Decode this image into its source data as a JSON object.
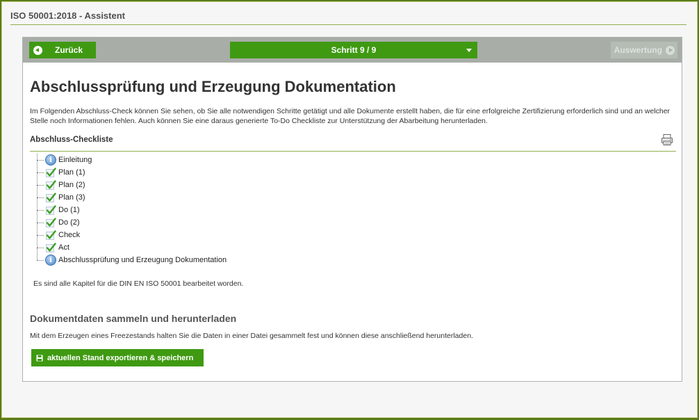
{
  "window": {
    "title": "ISO 50001:2018 - Assistent"
  },
  "toolbar": {
    "back_label": "Zurück",
    "step_label": "Schritt 9 / 9",
    "next_label": "Auswertung"
  },
  "main": {
    "heading": "Abschlussprüfung und Erzeugung Dokumentation",
    "intro": "Im Folgenden Abschluss-Check können Sie sehen, ob Sie alle notwendigen Schritte getätigt und alle Dokumente erstellt haben, die für eine erfolgreiche Zertifizierung erforderlich sind und an welcher Stelle noch Informationen fehlen. Auch können Sie eine daraus generierte To-Do Checkliste zur Unterstützung der Abarbeitung herunterladen.",
    "checklist_title": "Abschluss-Checkliste",
    "checklist": [
      {
        "label": "Einleitung",
        "icon": "info-icon"
      },
      {
        "label": "Plan (1)",
        "icon": "check-icon"
      },
      {
        "label": "Plan (2)",
        "icon": "check-icon"
      },
      {
        "label": "Plan (3)",
        "icon": "check-icon"
      },
      {
        "label": "Do (1)",
        "icon": "check-icon"
      },
      {
        "label": "Do (2)",
        "icon": "check-icon"
      },
      {
        "label": "Check",
        "icon": "check-icon"
      },
      {
        "label": "Act",
        "icon": "check-icon"
      },
      {
        "label": "Abschlussprüfung und Erzeugung Dokumentation",
        "icon": "info-icon"
      }
    ],
    "status_text": "Es sind alle Kapitel für die DIN EN ISO 50001 bearbeitet worden.",
    "section2_title": "Dokumentdaten sammeln und herunterladen",
    "section2_desc": "Mit dem Erzeugen eines Freezestands halten Sie die Daten in einer Datei gesammelt fest und können diese anschließend herunterladen.",
    "export_label": "aktuellen Stand exportieren & speichern"
  },
  "colors": {
    "accent": "#3f9a12",
    "toolbar_bg": "#a8ada8",
    "rule": "#8cb050"
  }
}
